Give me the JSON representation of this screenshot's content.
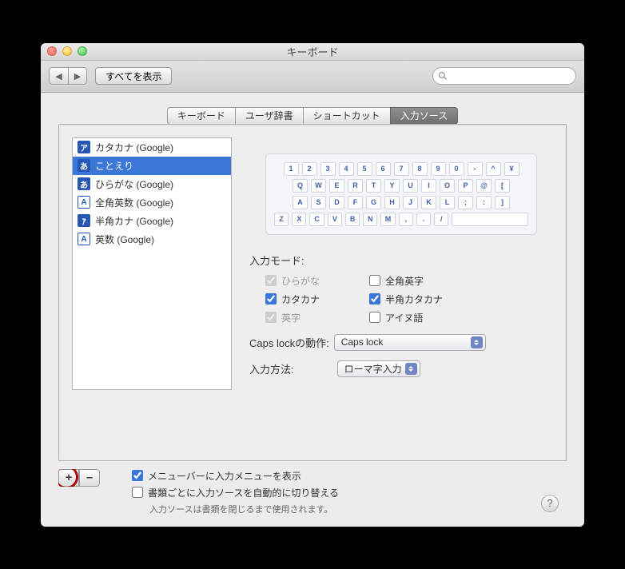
{
  "window": {
    "title": "キーボード"
  },
  "toolbar": {
    "show_all": "すべてを表示",
    "search_placeholder": ""
  },
  "tabs": [
    "キーボード",
    "ユーザ辞書",
    "ショートカット",
    "入力ソース"
  ],
  "selected_tab": 3,
  "sources": [
    {
      "icon": "ア",
      "label": "カタカナ (Google)"
    },
    {
      "icon": "あ",
      "label": "ことえり"
    },
    {
      "icon": "あ",
      "label": "ひらがな (Google)"
    },
    {
      "icon": "A",
      "label": "全角英数 (Google)"
    },
    {
      "icon": "ｱ",
      "label": "半角カナ (Google)"
    },
    {
      "icon": "A",
      "label": "英数 (Google)"
    }
  ],
  "selected_source": 1,
  "keyboard_rows": [
    [
      "1",
      "2",
      "3",
      "4",
      "5",
      "6",
      "7",
      "8",
      "9",
      "0",
      "-",
      "^",
      "¥"
    ],
    [
      "Q",
      "W",
      "E",
      "R",
      "T",
      "Y",
      "U",
      "I",
      "O",
      "P",
      "@",
      "["
    ],
    [
      "A",
      "S",
      "D",
      "F",
      "G",
      "H",
      "J",
      "K",
      "L",
      ";",
      ":",
      "]"
    ],
    [
      "Z",
      "X",
      "C",
      "V",
      "B",
      "N",
      "M",
      ",",
      ".",
      "/",
      " "
    ]
  ],
  "input_mode_label": "入力モード:",
  "modes": {
    "hiragana": {
      "label": "ひらがな",
      "checked": true,
      "disabled": true
    },
    "zenkaku": {
      "label": "全角英字",
      "checked": false,
      "disabled": false
    },
    "katakana": {
      "label": "カタカナ",
      "checked": true,
      "disabled": false
    },
    "hankata": {
      "label": "半角カタカナ",
      "checked": true,
      "disabled": false
    },
    "eiji": {
      "label": "英字",
      "checked": true,
      "disabled": true
    },
    "ainu": {
      "label": "アイヌ語",
      "checked": false,
      "disabled": false
    }
  },
  "capslock_label": "Caps lockの動作:",
  "capslock_value": "Caps lock",
  "input_method_label": "入力方法:",
  "input_method_value": "ローマ字入力",
  "add_label": "+",
  "remove_label": "–",
  "bottom": {
    "show_menu": "メニューバーに入力メニューを表示",
    "auto_switch": "書類ごとに入力ソースを自動的に切り替える",
    "footnote": "入力ソースは書類を閉じるまで使用されます。"
  },
  "help_label": "?"
}
